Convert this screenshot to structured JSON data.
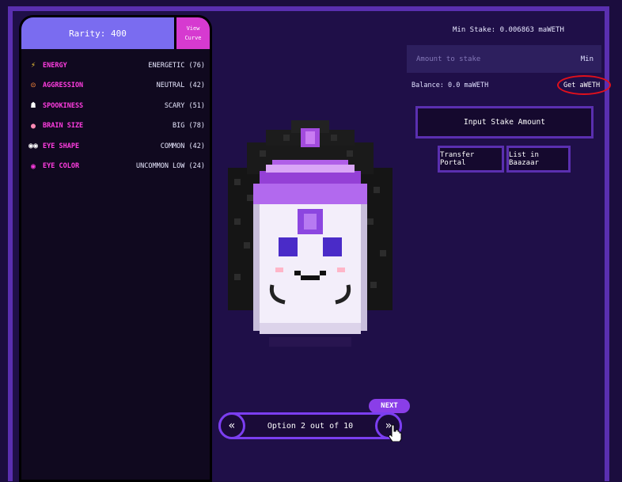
{
  "left_panel": {
    "rarity_label": "Rarity: 400",
    "view_curve_line1": "View",
    "view_curve_line2": "Curve",
    "traits": [
      {
        "icon": "lightning-icon",
        "name": "ENERGY",
        "value": "ENERGETIC (76)"
      },
      {
        "icon": "angry-face-icon",
        "name": "AGGRESSION",
        "value": "NEUTRAL (42)"
      },
      {
        "icon": "ghost-icon",
        "name": "SPOOKINESS",
        "value": "SCARY (51)"
      },
      {
        "icon": "brain-icon",
        "name": "BRAIN SIZE",
        "value": "BIG (78)"
      },
      {
        "icon": "eyes-icon",
        "name": "EYE SHAPE",
        "value": "COMMON (42)"
      },
      {
        "icon": "eye-icon",
        "name": "EYE COLOR",
        "value": "UNCOMMON LOW (24)"
      }
    ]
  },
  "stake": {
    "min_stake": "Min Stake: 0.006863 maWETH",
    "amount_placeholder": "Amount to stake",
    "min_label": "Min",
    "balance": "Balance: 0.0 maWETH",
    "get_aweth": "Get aWETH",
    "input_stake_amount": "Input Stake Amount",
    "transfer_portal": "Transfer Portal",
    "list_in_baazaar": "List in Baazaar"
  },
  "pager": {
    "next_label": "NEXT",
    "option_text": "Option 2 out of 10",
    "prev_glyph": "«",
    "next_glyph": "»"
  },
  "colors": {
    "background": "#1b0d3e",
    "accent_purple": "#7b3ef0",
    "trait_pink": "#ff3de0",
    "rarity_blue": "#7a6cf0",
    "highlight_red": "#e0101c"
  }
}
